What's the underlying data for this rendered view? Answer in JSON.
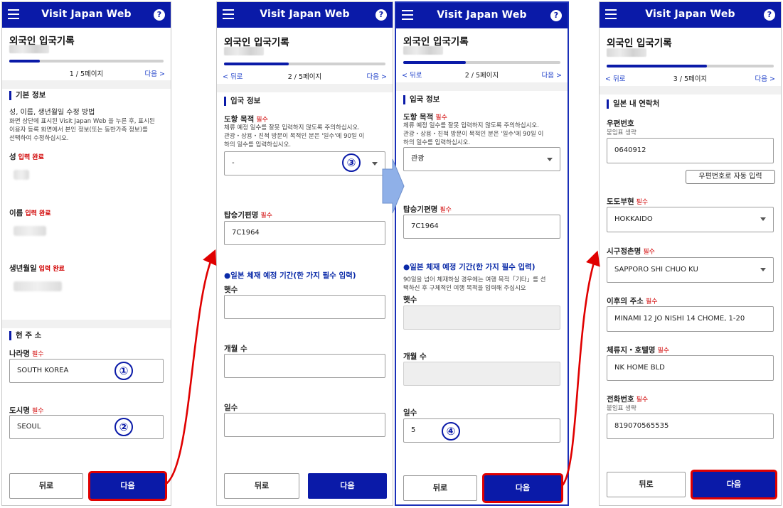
{
  "app": {
    "title": "Visit Japan Web",
    "help": "?"
  },
  "page_title": "외국인 입국기록",
  "screens": [
    {
      "progress": {
        "label": "1 / 5페이지",
        "next": "다음 >",
        "fraction": 0.2
      },
      "basic": {
        "heading": "기본 정보",
        "how_title": "성, 이름, 생년월일 수정 방법",
        "how_text": [
          "화면 상단에 표시된 Visit Japan Web 을 누른 후, 표시된",
          "이용자 등록 화면에서 본인 정보(또는 동반가족 정보)를",
          "선택하여 수정하십시오."
        ],
        "surname": "성",
        "given": "이름",
        "dob": "생년월일",
        "done": "입력 완료"
      },
      "address": {
        "heading": "현 주 소",
        "country_label": "나라명",
        "country_value": "SOUTH KOREA",
        "city_label": "도시명",
        "city_value": "SEOUL",
        "required": "필수"
      },
      "buttons": {
        "back": "뒤로",
        "next": "다음"
      },
      "markers": [
        "①",
        "②"
      ]
    },
    {
      "progress": {
        "back": "< 뒤로",
        "label": "2 / 5페이지",
        "next": "다음 >",
        "fraction": 0.4
      },
      "entry": {
        "heading": "입국 정보",
        "purpose_label": "도항 목적",
        "required": "필수",
        "purpose_help": [
          "체류 예정 일수를 잘못 입력하지 않도록 주의하십시오.",
          "관광・상용・친척 방문이 목적인 분은 '일수'에 90일 이",
          "하의 일수를 입력하십시오."
        ],
        "purpose_value": "-",
        "flight_label": "탑승기편명",
        "flight_value": "7C1964",
        "stay_heading": "●일본 체재 예정 기간(한 가지 필수 입력)",
        "years": "햇수",
        "months": "개월 수",
        "days": "일수"
      },
      "buttons": {
        "back": "뒤로",
        "next": "다음"
      },
      "markers": [
        "③"
      ]
    },
    {
      "progress": {
        "back": "< 뒤로",
        "label": "2 / 5페이지",
        "next": "다음 >",
        "fraction": 0.4
      },
      "entry": {
        "heading": "입국 정보",
        "purpose_label": "도항 목적",
        "required": "필수",
        "purpose_help": [
          "체류 예정 일수를 잘못 입력하지 않도록 주의하십시오.",
          "관광・상용・친척 방문이 목적인 분은 '일수'에 90일 이",
          "하의 일수를 입력하십시오."
        ],
        "purpose_value": "관광",
        "flight_label": "탑승기편명",
        "flight_value": "7C1964",
        "stay_heading": "●일본 체재 예정 기간(한 가지 필수 입력)",
        "stay_help": [
          "90일을 넘어 체재하실 경우에는 여행 목적「기타」를 선",
          "택하신 후 구체적인 여행 목적을 입력해 주십시오"
        ],
        "years": "햇수",
        "months": "개월 수",
        "days": "일수",
        "days_value": "5"
      },
      "buttons": {
        "back": "뒤로",
        "next": "다음"
      },
      "markers": [
        "④"
      ]
    },
    {
      "progress": {
        "back": "< 뒤로",
        "label": "3 / 5페이지",
        "next": "다음 >",
        "fraction": 0.6
      },
      "contact": {
        "heading": "일본 내 연락처",
        "zip_label": "우편번호",
        "zip_sub": "붙임표 생략",
        "zip_value": "0640912",
        "zip_button": "우편번호로 자동 입력",
        "pref_label": "도도부현",
        "pref_value": "HOKKAIDO",
        "city_label": "시구정촌명",
        "city_value": "SAPPORO SHI CHUO KU",
        "addr_label": "이후의 주소",
        "addr_value": "MINAMI 12 JO NISHI 14 CHOME, 1-20",
        "hotel_label": "체류지・호텔명",
        "hotel_value": "NK HOME BLD",
        "phone_label": "전화번호",
        "phone_sub": "붙임표 생략",
        "phone_value": "819070565535",
        "required": "필수"
      },
      "buttons": {
        "back": "뒤로",
        "next": "다음"
      }
    }
  ],
  "colors": {
    "brand": "#0a1aa8",
    "required": "#d10000",
    "highlight": "#e00000",
    "arrow": "#8fb0e8"
  }
}
